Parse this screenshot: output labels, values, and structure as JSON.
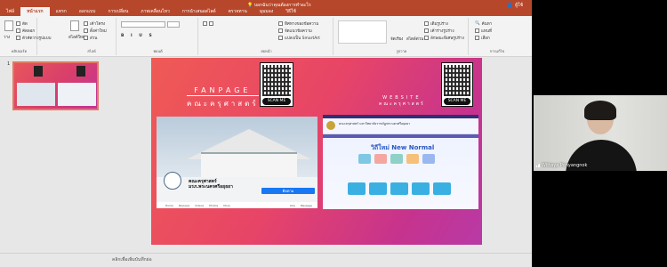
{
  "window": {
    "title": "การนำเสนอ1 - PowerPoint",
    "tell_me": "บอกฉันว่าคุณต้องการทำอะไร",
    "user_name": "ผู้ใช้"
  },
  "ribbon_tabs": [
    "ไฟล์",
    "หน้าแรก",
    "แทรก",
    "ออกแบบ",
    "การเปลี่ยน",
    "ภาพเคลื่อนไหว",
    "การนำเสนอสไลด์",
    "ตรวจทาน",
    "มุมมอง",
    "วิธีใช้"
  ],
  "ribbon": {
    "clipboard": {
      "paste": "วาง",
      "label": "คลิปบอร์ด",
      "cut": "ตัด",
      "copy": "คัดลอก",
      "format": "ตัวคัดวางรูปแบบ"
    },
    "slides": {
      "new_slide": "สไลด์ใหม่",
      "layout": "เค้าโครง",
      "reset": "ตั้งค่าใหม่",
      "section": "ส่วน",
      "label": "สไลด์"
    },
    "font": {
      "label": "ฟอนต์"
    },
    "paragraph": {
      "label": "ย่อหน้า",
      "text_direction": "ทิศทางของข้อความ",
      "align_text": "จัดแนวข้อความ",
      "smartart": "แปลงเป็น SmartArt"
    },
    "drawing": {
      "label": "รูปวาด",
      "arrange": "จัดเรียง",
      "quick_styles": "สไตล์ด่วน"
    },
    "shape_fill": "เติมรูปร่าง",
    "shape_outline": "เค้าร่างรูปร่าง",
    "shape_effects": "ลักษณะพิเศษรูปร่าง",
    "editing": {
      "label": "การแก้ไข",
      "find": "ค้นหา",
      "replace": "แทนที่",
      "select": "เลือก"
    }
  },
  "thumbnail": {
    "number": "1"
  },
  "slide": {
    "fanpage_title": "FANPAGE",
    "fanpage_subtitle": "คณะครุศาสตร์",
    "website_title": "WEBSITE",
    "website_subtitle": "คณะครุศาสตร์",
    "scan_me": "SCAN ME",
    "fb_page_name": "คณะครุศาสตร์",
    "fb_page_name2": "มรภ.พระนครศรีอยุธยา",
    "fb_follow": "ติดตาม",
    "fb_nav": [
      "Home",
      "Reviews",
      "Videos",
      "Photos",
      "More"
    ],
    "fb_like": "Like",
    "fb_message": "Message",
    "web_header": "คณะครุศาสตร์ มหาวิทยาลัยราชภัฏพระนครศรีอยุธยา",
    "web_banner": "วิถีใหม่ New Normal"
  },
  "notes_placeholder": "คลิกเพื่อเพิ่มบันทึกย่อ",
  "webcam": {
    "participant": "Wittaya Ponyangnok"
  },
  "colors": {
    "accent": "#b7472a",
    "slide_start": "#ef5a55",
    "slide_end": "#b83aa6"
  }
}
